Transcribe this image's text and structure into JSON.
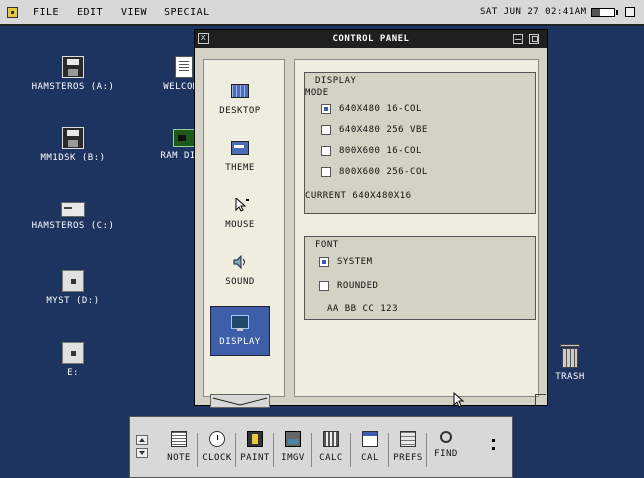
{
  "menubar": {
    "items": [
      "FILE",
      "EDIT",
      "VIEW",
      "SPECIAL"
    ],
    "clock": "SAT JUN 27 02:41AM",
    "battery_level": 0.35
  },
  "desktop": {
    "icons": [
      {
        "label": "HAMSTEROS (A:)",
        "icon": "floppy-disk-icon"
      },
      {
        "label": "WELCOME",
        "icon": "document-icon"
      },
      {
        "label": "MM1DSK (B:)",
        "icon": "floppy-disk-icon"
      },
      {
        "label": "RAM DISK",
        "icon": "memory-chip-icon"
      },
      {
        "label": "HAMSTEROS (C:)",
        "icon": "hard-drive-icon"
      },
      {
        "label": "MYST (D:)",
        "icon": "cd-drive-icon"
      },
      {
        "label": "E:",
        "icon": "cd-drive-icon"
      },
      {
        "label": "TRASH",
        "icon": "trash-icon"
      }
    ]
  },
  "window": {
    "title": "CONTROL PANEL",
    "close_glyph": "x",
    "categories": [
      {
        "label": "DESKTOP",
        "icon": "desktop-icon"
      },
      {
        "label": "THEME",
        "icon": "theme-icon"
      },
      {
        "label": "MOUSE",
        "icon": "mouse-pointer-icon"
      },
      {
        "label": "SOUND",
        "icon": "speaker-icon"
      },
      {
        "label": "DISPLAY",
        "icon": "monitor-icon",
        "selected": true
      }
    ],
    "display": {
      "title": "DISPLAY",
      "mode_label": "MODE",
      "modes": [
        {
          "label": "640X480 16-COL",
          "checked": true
        },
        {
          "label": "640X480 256 VBE",
          "checked": false
        },
        {
          "label": "800X600 16-COL",
          "checked": false
        },
        {
          "label": "800X600 256-COL",
          "checked": false
        }
      ],
      "current": "CURRENT 640X480X16"
    },
    "font": {
      "title": "FONT",
      "options": [
        {
          "label": "SYSTEM",
          "checked": true
        },
        {
          "label": "ROUNDED",
          "checked": false
        }
      ],
      "preview": "AA BB CC 123"
    }
  },
  "dock": {
    "apps": [
      {
        "label": "NOTE",
        "icon": "note-icon"
      },
      {
        "label": "CLOCK",
        "icon": "clock-icon"
      },
      {
        "label": "PAINT",
        "icon": "paint-icon"
      },
      {
        "label": "IMGV",
        "icon": "image-viewer-icon"
      },
      {
        "label": "CALC",
        "icon": "calculator-icon"
      },
      {
        "label": "CAL",
        "icon": "calendar-icon"
      },
      {
        "label": "PREFS",
        "icon": "preferences-icon"
      },
      {
        "label": "FIND",
        "icon": "find-icon"
      }
    ]
  },
  "colors": {
    "desktop_bg": "#1d3461",
    "accent": "#3d5ea8",
    "window_bg": "#d4d2c4"
  }
}
